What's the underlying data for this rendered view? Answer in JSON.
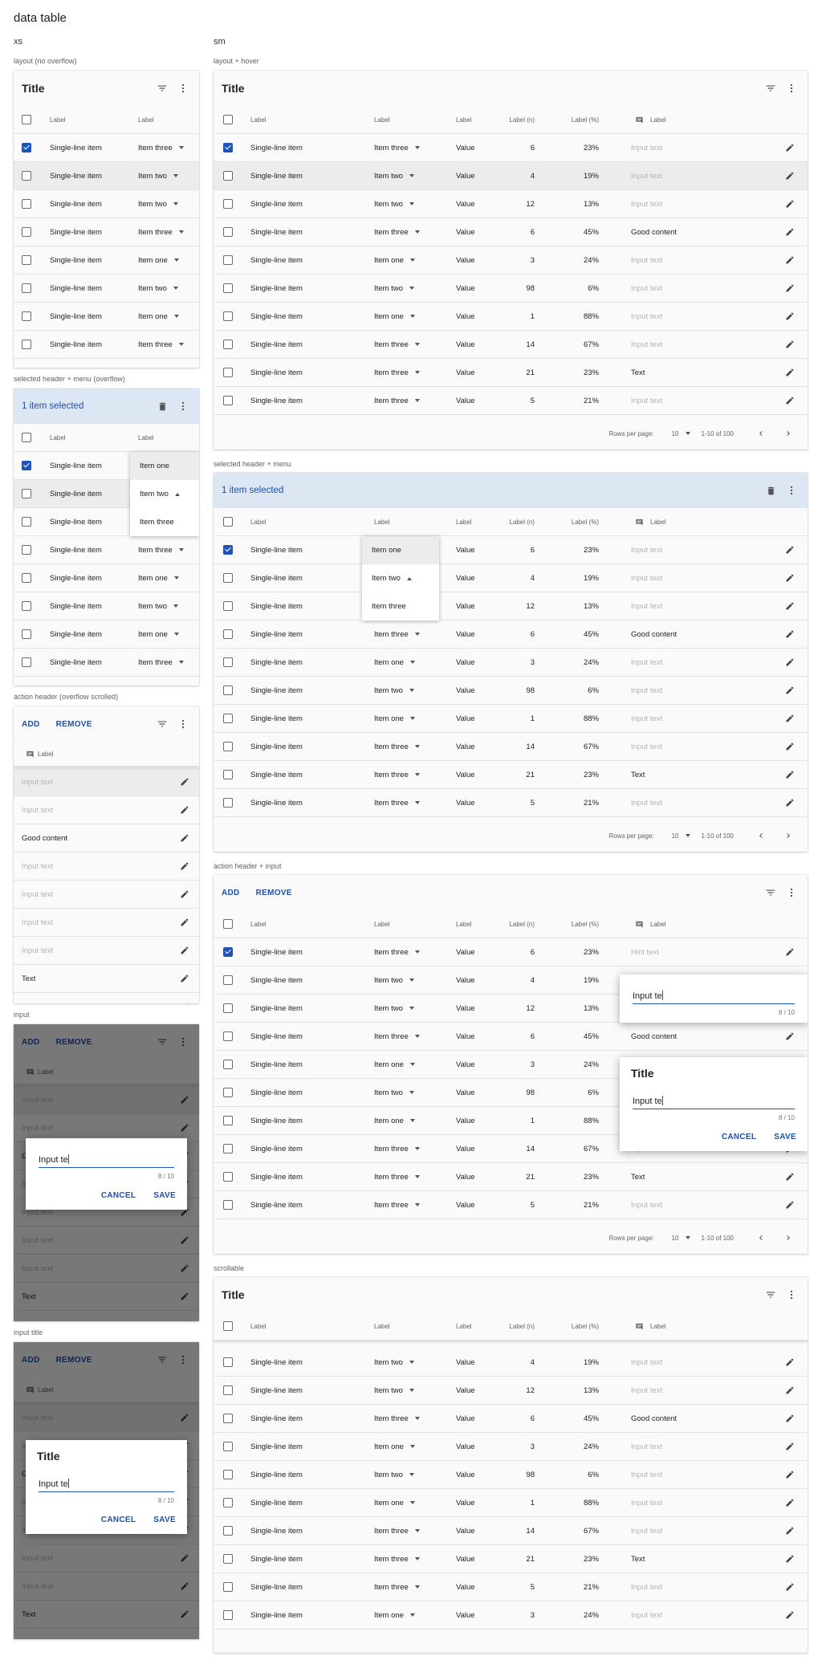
{
  "page": {
    "title": "data table",
    "bp_xs": "xs",
    "bp_sm": "sm"
  },
  "captions": {
    "layout": "layout (no overflow)",
    "selected": "selected header + menu (overflow)",
    "actionScroll": "action header (overflow scrolled)",
    "input": "input",
    "inputTitle": "input title",
    "layoutHover": "layout + hover",
    "selectedMenu": "selected header + menu",
    "actionInput": "action header + input",
    "scrollable": "scrollable"
  },
  "toolbar": {
    "title": "Title",
    "selected": "1 item selected",
    "add": "ADD",
    "remove": "REMOVE"
  },
  "headers": {
    "label": "Label",
    "label_n": "Label (n)",
    "label_pct": "Label (%)"
  },
  "rows": [
    {
      "name": "Single-line item",
      "item": "Item three",
      "value": "Value",
      "n": "6",
      "pct": "23%",
      "input": "Input text",
      "checked": true
    },
    {
      "name": "Single-line item",
      "item": "Item two",
      "value": "Value",
      "n": "4",
      "pct": "19%",
      "input": "Input text",
      "checked": false
    },
    {
      "name": "Single-line item",
      "item": "Item two",
      "value": "Value",
      "n": "12",
      "pct": "13%",
      "input": "Input text",
      "checked": false
    },
    {
      "name": "Single-line item",
      "item": "Item three",
      "value": "Value",
      "n": "6",
      "pct": "45%",
      "input": "Good content",
      "checked": false
    },
    {
      "name": "Single-line item",
      "item": "Item one",
      "value": "Value",
      "n": "3",
      "pct": "24%",
      "input": "Input text",
      "checked": false
    },
    {
      "name": "Single-line item",
      "item": "Item two",
      "value": "Value",
      "n": "98",
      "pct": "6%",
      "input": "Input text",
      "checked": false
    },
    {
      "name": "Single-line item",
      "item": "Item one",
      "value": "Value",
      "n": "1",
      "pct": "88%",
      "input": "Input text",
      "checked": false
    },
    {
      "name": "Single-line item",
      "item": "Item three",
      "value": "Value",
      "n": "14",
      "pct": "67%",
      "input": "Input text",
      "checked": false
    },
    {
      "name": "Single-line item",
      "item": "Item three",
      "value": "Value",
      "n": "21",
      "pct": "23%",
      "input": "Text",
      "checked": false
    },
    {
      "name": "Single-line item",
      "item": "Item three",
      "value": "Value",
      "n": "5",
      "pct": "21%",
      "input": "Input text",
      "checked": false
    }
  ],
  "scrollRow": {
    "name": "Single-line item",
    "item": "Item one",
    "value": "Value",
    "n": "3",
    "pct": "24%",
    "input": "Input text"
  },
  "menu": {
    "items": [
      "Item one",
      "Item two",
      "Item three"
    ]
  },
  "footer": {
    "rows_label": "Rows per page:",
    "rows_value": "10",
    "range": "1-10 of 100"
  },
  "editing": {
    "hint": "Hint text",
    "value": "Input te",
    "counter": "8 / 10",
    "cancel": "CANCEL",
    "save": "SAVE",
    "title": "Title"
  },
  "colors": {
    "accent": "#1e54b7",
    "selected_bg": "#dde6f3",
    "hover_bg": "#ececec"
  }
}
